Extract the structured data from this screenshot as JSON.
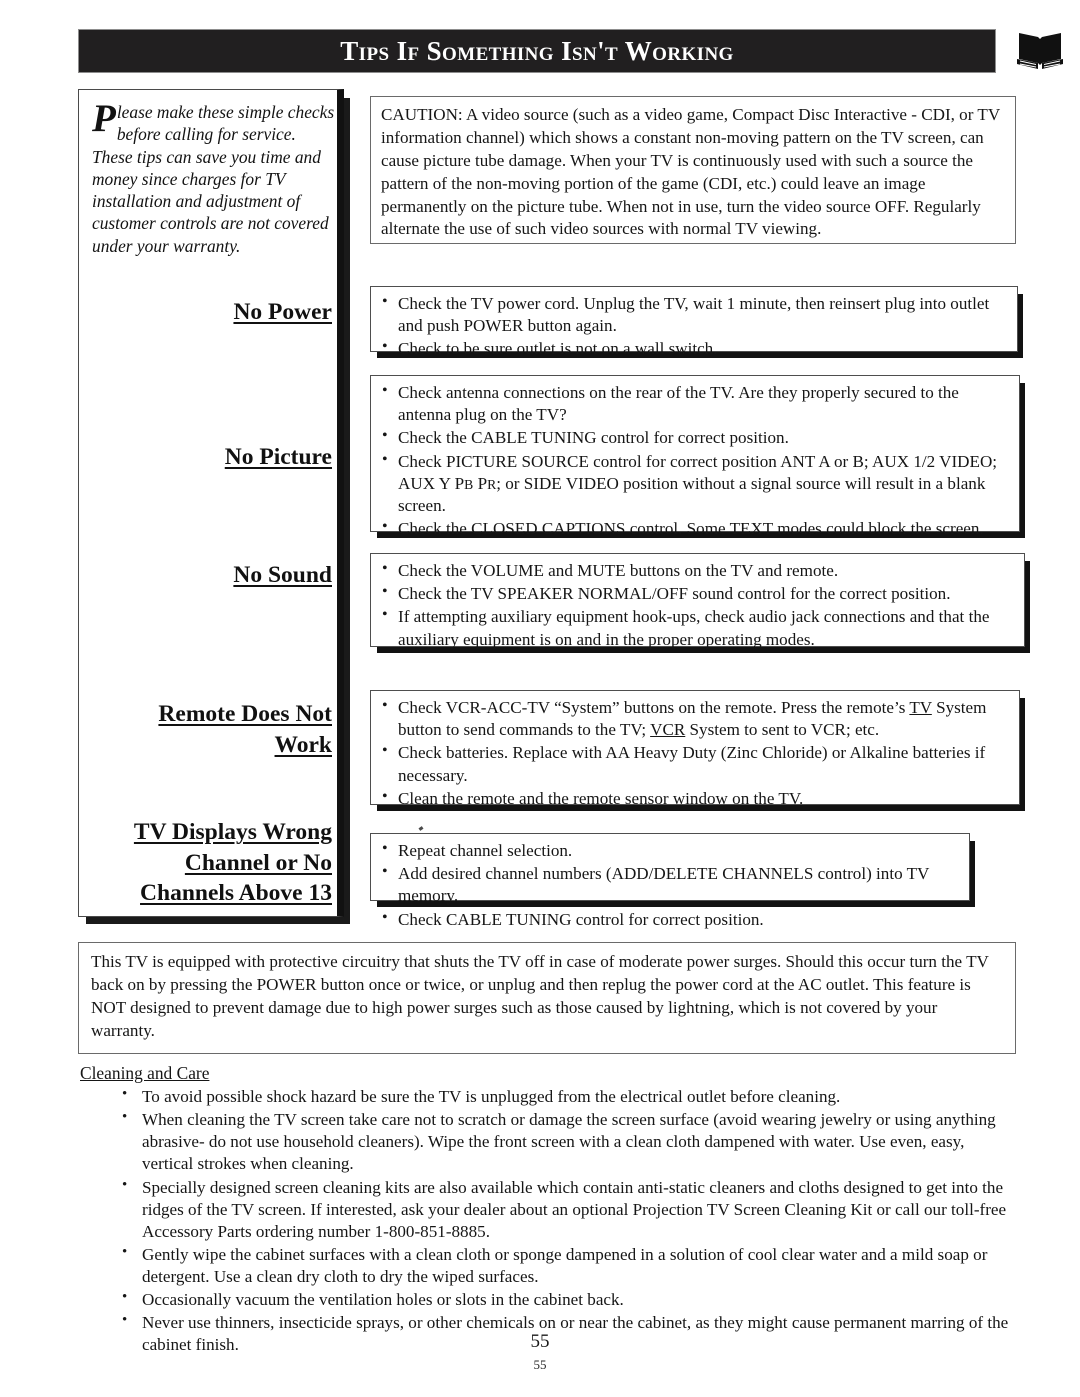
{
  "header": {
    "title": "Tips If Something Isn't Working",
    "icon": "open-book-icon"
  },
  "intro": {
    "dropcap": "P",
    "text": "lease make these simple checks before calling for service.  These tips can save you time and money since charges for TV installation and adjustment of customer controls are not covered under your warranty."
  },
  "caution": {
    "text": "CAUTION: A video source (such as a video game, Compact Disc Interactive - CDI, or TV information channel) which shows a constant non-moving pattern on the TV screen, can cause picture tube damage. When your TV is continuously used with such a source the pattern of the non-moving portion of the game (CDI, etc.) could leave an image permanently on the picture tube. When not in use, turn the video source OFF. Regularly alternate the use of such video sources with normal TV viewing."
  },
  "sections": [
    {
      "heading_lines": [
        "No Power"
      ],
      "bullets": [
        "Check the TV power cord. Unplug the TV, wait 1 minute, then reinsert plug into outlet and push POWER button again.",
        "Check to be sure outlet is not on a wall switch."
      ]
    },
    {
      "heading_lines": [
        "No Picture"
      ],
      "bullets": [
        "Check antenna connections on the rear of the TV. Are they properly secured to the antenna plug on the TV?",
        "Check the CABLE TUNING control for correct position.",
        "Check PICTURE SOURCE control for correct position ANT A or B; AUX 1/2 VIDEO; AUX Y PB PR; or SIDE VIDEO position without a signal source will result in a blank screen.",
        "Check the CLOSED CAPTIONS control. Some TEXT modes could block the screen."
      ]
    },
    {
      "heading_lines": [
        "No Sound"
      ],
      "bullets": [
        "Check the VOLUME and MUTE buttons on the TV and remote.",
        "Check the TV SPEAKER NORMAL/OFF sound control for the correct position.",
        "If attempting auxiliary equipment hook-ups, check audio jack connections and that the auxiliary equipment is on and in the proper operating modes."
      ]
    },
    {
      "heading_lines": [
        "Remote Does Not",
        "Work"
      ],
      "bullets": [
        "Check VCR-ACC-TV “System” buttons on the remote. Press the remote’s TV System button to send commands to the TV; VCR System to sent to VCR; etc.",
        "Check batteries.  Replace with AA Heavy Duty (Zinc Chloride) or Alkaline batteries if necessary.",
        "Clean the remote and the remote sensor window on the TV."
      ]
    },
    {
      "heading_lines": [
        "TV Displays Wrong",
        "Channel or No",
        "Channels Above 13"
      ],
      "bullets": [
        "Repeat channel selection.",
        "Add desired channel numbers (ADD/DELETE CHANNELS control) into TV memory.",
        "Check CABLE TUNING control for correct position."
      ]
    }
  ],
  "surge": {
    "text": "This TV is equipped with protective circuitry that shuts the TV off in case of moderate power surges. Should this occur turn the TV back on by pressing the POWER button once or twice, or unplug and then replug the power cord at the AC outlet. This feature is NOT designed to prevent damage due to high power surges such as those caused by lightning, which is not covered by your warranty."
  },
  "cleaning": {
    "title": "Cleaning and Care",
    "bullets": [
      "To avoid possible shock hazard be sure the TV is unplugged from the electrical outlet before cleaning.",
      "When cleaning the TV screen take care not to scratch or damage the screen surface (avoid wearing jewelry or using anything abrasive- do not use household cleaners). Wipe the front screen with a clean cloth dampened with water.  Use even, easy, vertical strokes when cleaning.",
      "Specially designed screen cleaning kits are also available which contain anti-static cleaners and cloths designed to get into the ridges of the TV screen. If interested, ask your dealer about an optional Projection TV Screen Cleaning Kit or call our toll-free Accessory Parts ordering number 1-800-851-8885.",
      "Gently wipe the cabinet surfaces with a clean cloth or sponge dampened in a solution of cool clear water and a mild soap or detergent. Use a clean dry cloth to dry the wiped surfaces.",
      "Occasionally vacuum the ventilation holes or slots in the cabinet back.",
      "Never use thinners, insecticide sprays, or other chemicals on or near the cabinet, as they might cause permanent marring of the cabinet finish."
    ]
  },
  "footer": {
    "page_number": "55",
    "page_number_small": "55"
  },
  "colors": {
    "banner": "#211f20",
    "text": "#161616",
    "shadow": "#121212"
  }
}
